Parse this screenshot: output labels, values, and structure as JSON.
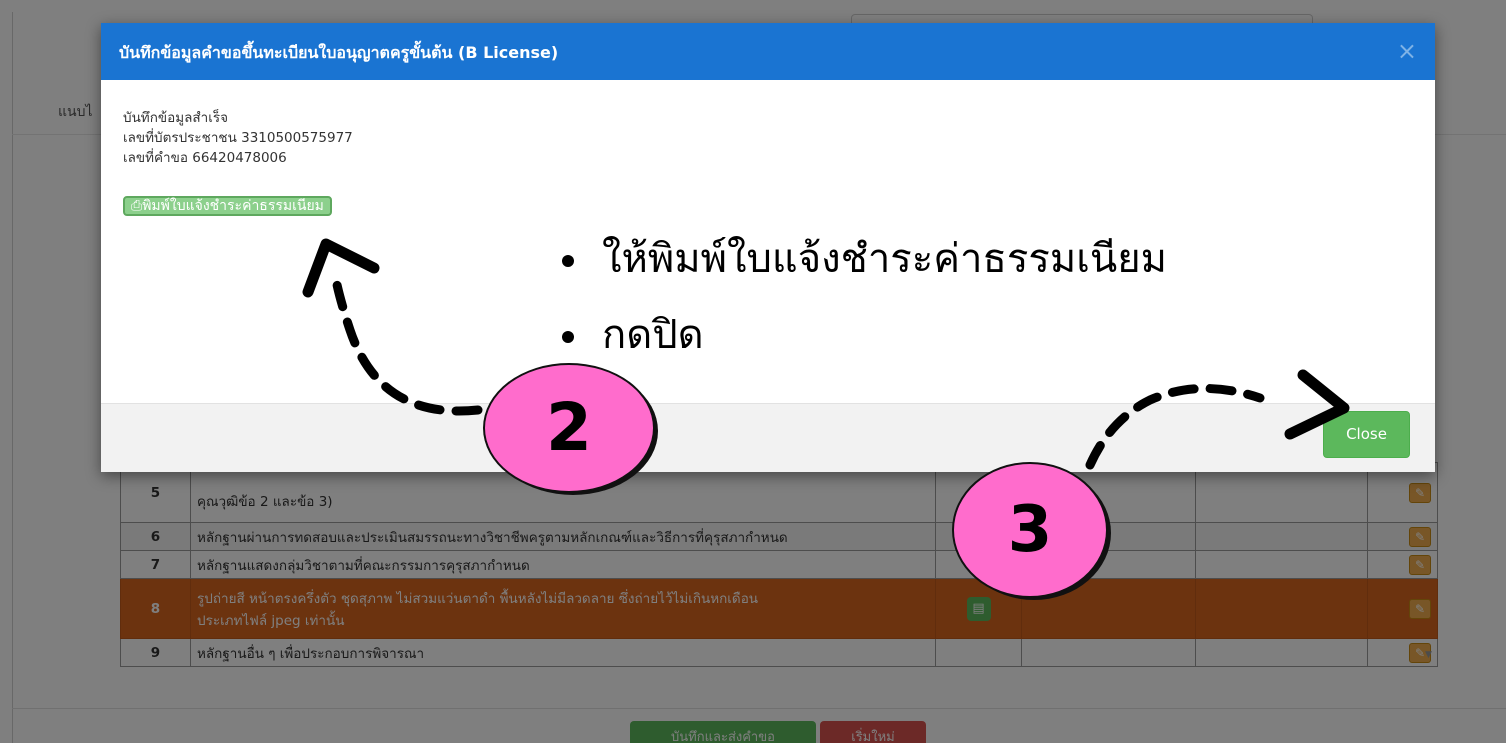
{
  "page": {
    "tab_label": "แนบไ",
    "rows": [
      {
        "no": "5",
        "desc": "คุณวุฒิข้อ 2 และข้อ 3)"
      },
      {
        "no": "6",
        "desc": "หลักฐานผ่านการทดสอบและประเมินสมรรถนะทางวิชาชีพครูตามหลักเกณฑ์และวิธีการที่คุรุสภากำหนด"
      },
      {
        "no": "7",
        "desc": "หลักฐานแสดงกลุ่มวิชาตามที่คณะกรรมการคุรุสภากำหนด"
      },
      {
        "no": "8",
        "desc_line1": "รูปถ่ายสี หน้าตรงครึ่งตัว ชุดสุภาพ ไม่สวมแว่นตาดำ พื้นหลังไม่มีลวดลาย ซึ่งถ่ายไว้ไม่เกินหกเดือน",
        "desc_line2": "ประเภทไฟล์ jpeg เท่านั้น"
      },
      {
        "no": "9",
        "desc": "หลักฐานอื่น ๆ เพื่อประกอบการพิจารณา"
      }
    ],
    "edit_icon": "edit-icon",
    "file_icon": "file-icon",
    "save_button_label": "บันทึกและส่งคำขอ",
    "new_button_label": "เริ่มใหม่"
  },
  "modal": {
    "title": "บันทึกข้อมูลคำขอขึ้นทะเบียนใบอนุญาตครูขั้นต้น (B License)",
    "close_x": "×",
    "message_success": "บันทึกข้อมูลสำเร็จ",
    "id_card_line": "เลขที่บัตรประชาชน 3310500575977",
    "request_no_line": "เลขที่คำขอ 66420478006",
    "print_button_label": "พิมพ์ใบแจ้งชำระค่าธรรมเนียม",
    "close_button_label": "Close"
  },
  "annotations": {
    "bullet_1": "ให้พิมพ์ใบแจ้งชำระค่าธรรมเนียม",
    "bullet_2": "กดปิด",
    "step_2": "2",
    "step_3": "3",
    "circle_color": "#ff6ccc"
  },
  "colors": {
    "modal_header": "#1a74d2",
    "highlight_row": "#d9661f",
    "close_button": "#5cb85c"
  }
}
